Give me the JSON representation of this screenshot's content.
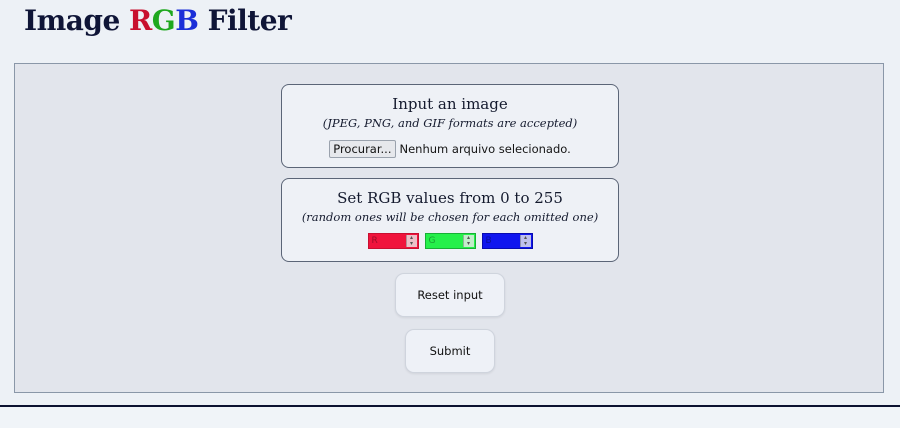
{
  "header": {
    "title_prefix": "Image",
    "title_r": "R",
    "title_g": "G",
    "title_b": "B",
    "title_suffix": "Filter"
  },
  "upload": {
    "heading": "Input an image",
    "subtitle": "(JPEG, PNG, and GIF formats are accepted)",
    "browse_label": "Procurar...",
    "status_text": "Nenhum arquivo selecionado."
  },
  "rgb": {
    "heading": "Set RGB values from 0 to 255",
    "subtitle": "(random ones will be chosen for each omitted one)",
    "red_placeholder": "R",
    "green_placeholder": "G",
    "blue_placeholder": "B",
    "colors": {
      "red": "#f0143c",
      "green": "#25f04a",
      "blue": "#1016ef"
    }
  },
  "actions": {
    "reset_label": "Reset input",
    "submit_label": "Submit"
  },
  "icons": {
    "spinner": "up-down-spinner-icon"
  }
}
